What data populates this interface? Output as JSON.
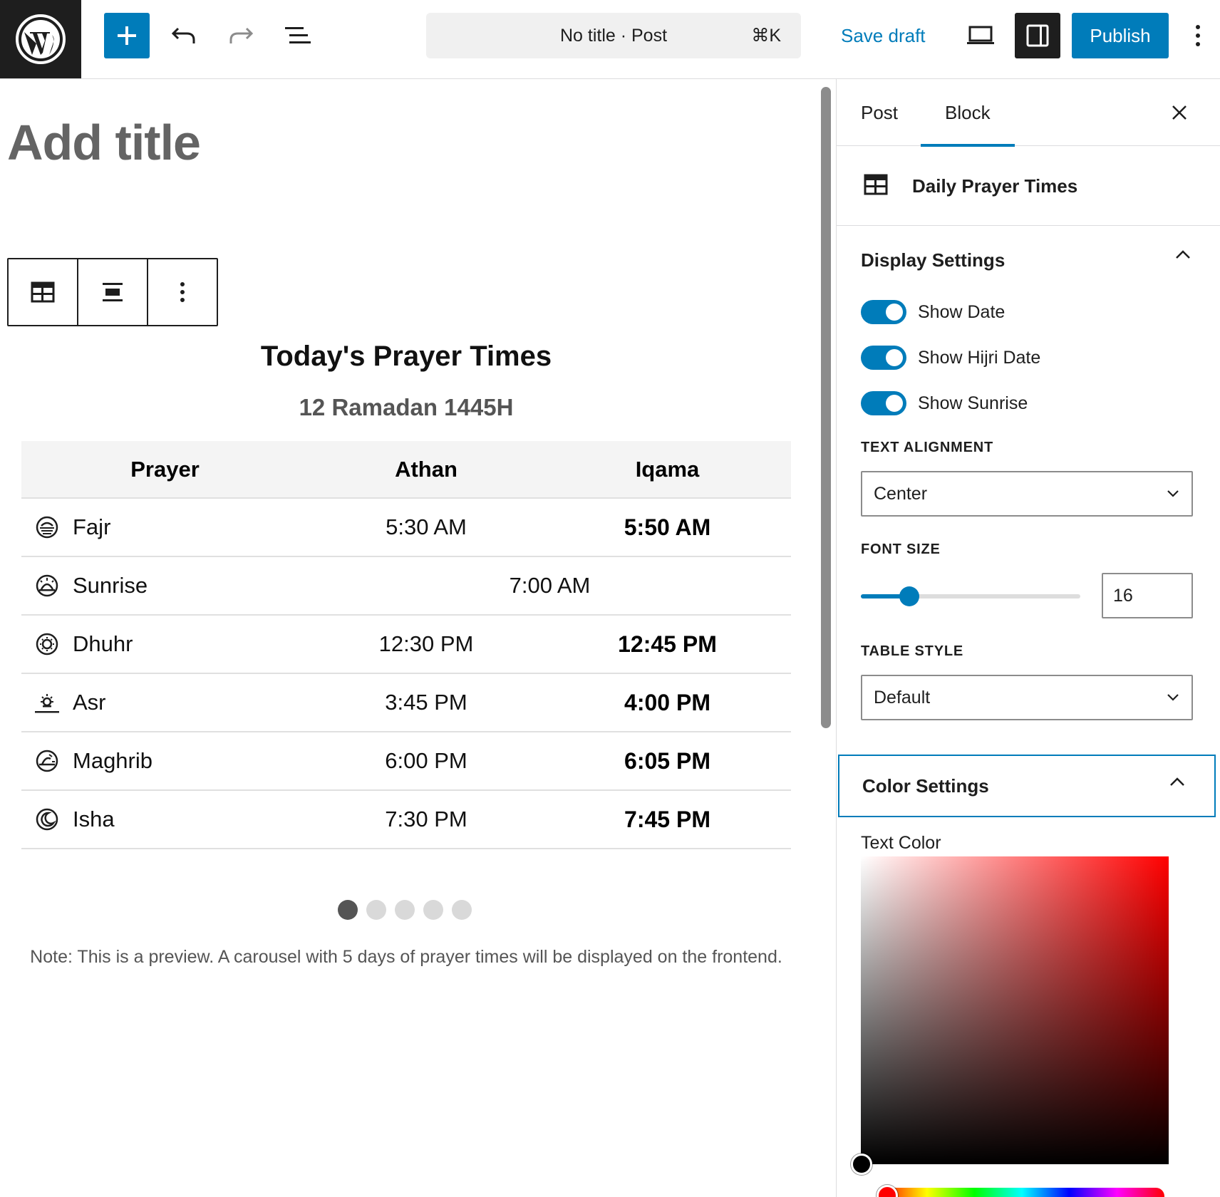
{
  "colors": {
    "accent": "#007cba",
    "dark": "#1e1e1e",
    "muted": "#555555"
  },
  "header": {
    "document_title": "No title · Post",
    "command_shortcut": "⌘K",
    "save_draft_label": "Save draft",
    "publish_label": "Publish",
    "icons": [
      "wordpress-logo-icon",
      "plus-icon",
      "undo-icon",
      "redo-icon",
      "document-overview-icon",
      "preview-desktop-icon",
      "sidebar-toggle-icon",
      "more-vertical-icon"
    ]
  },
  "editor": {
    "title_placeholder": "Add title",
    "block": {
      "heading": "Today's Prayer Times",
      "hijri_date": "12 Ramadan 1445H",
      "columns": [
        "Prayer",
        "Athan",
        "Iqama"
      ],
      "rows": [
        {
          "name": "Fajr",
          "athan": "5:30 AM",
          "iqama": "5:50 AM",
          "icon": "fajr-icon"
        },
        {
          "name": "Sunrise",
          "time": "7:00 AM",
          "icon": "sunrise-icon"
        },
        {
          "name": "Dhuhr",
          "athan": "12:30 PM",
          "iqama": "12:45 PM",
          "icon": "dhuhr-icon"
        },
        {
          "name": "Asr",
          "athan": "3:45 PM",
          "iqama": "4:00 PM",
          "icon": "asr-icon"
        },
        {
          "name": "Maghrib",
          "athan": "6:00 PM",
          "iqama": "6:05 PM",
          "icon": "maghrib-icon"
        },
        {
          "name": "Isha",
          "athan": "7:30 PM",
          "iqama": "7:45 PM",
          "icon": "isha-icon"
        }
      ],
      "carousel": {
        "total": 5,
        "active": 1
      },
      "note": "Note: This is a preview. A carousel with 5 days of prayer times will be displayed on the frontend."
    }
  },
  "sidebar": {
    "tabs": [
      {
        "label": "Post",
        "active": false
      },
      {
        "label": "Block",
        "active": true
      }
    ],
    "block_name": "Daily Prayer Times",
    "display_settings": {
      "title": "Display Settings",
      "toggles": [
        {
          "label": "Show Date",
          "on": true
        },
        {
          "label": "Show Hijri Date",
          "on": true
        },
        {
          "label": "Show Sunrise",
          "on": true
        }
      ],
      "text_alignment_label": "TEXT ALIGNMENT",
      "text_alignment_value": "Center",
      "font_size_label": "FONT SIZE",
      "font_size_value": "16",
      "font_size_fraction": 0.22,
      "table_style_label": "TABLE STYLE",
      "table_style_value": "Default"
    },
    "color_settings": {
      "title": "Color Settings",
      "text_color_label": "Text Color",
      "current_hex": "#000000"
    }
  }
}
